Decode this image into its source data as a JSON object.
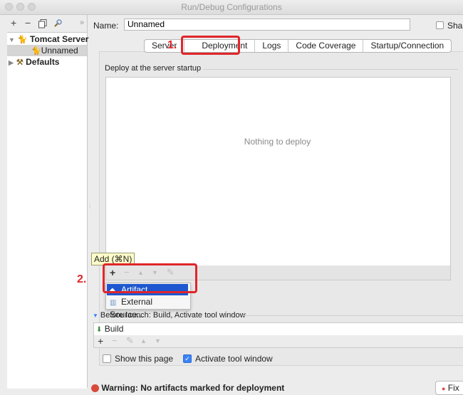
{
  "window": {
    "title": "Run/Debug Configurations"
  },
  "toolbar": {
    "add_icon": "+",
    "remove_icon": "−",
    "copy_icon": "copy-icon",
    "edit_icon": "wrench-icon",
    "more_icon": "»"
  },
  "tree": {
    "items": [
      {
        "label": "Tomcat Server",
        "level": 0,
        "expanded": true,
        "icon": "tomcat-icon"
      },
      {
        "label": "Unnamed",
        "level": 1,
        "selected": true,
        "icon": "tomcat-icon"
      },
      {
        "label": "Defaults",
        "level": 0,
        "expanded": false,
        "icon": "wrench-icon"
      }
    ]
  },
  "config": {
    "name_label": "Name:",
    "name_value": "Unnamed",
    "share_label": "Share"
  },
  "tabs": [
    {
      "label": "Server"
    },
    {
      "label": "Deployment",
      "selected": true
    },
    {
      "label": "Logs"
    },
    {
      "label": "Code Coverage"
    },
    {
      "label": "Startup/Connection"
    }
  ],
  "deployment": {
    "section_title": "Deploy at the server startup",
    "empty_text": "Nothing to deploy",
    "tooltip": "Add (⌘N)",
    "menu": [
      {
        "label": "Artifact...",
        "highlighted": true,
        "icon": "artifact-icon"
      },
      {
        "label": "External Source...",
        "icon": "external-source-icon"
      }
    ]
  },
  "annotations": {
    "step1": "1.",
    "step2": "2."
  },
  "before_launch": {
    "header": "Before launch: Build, Activate tool window",
    "items": [
      {
        "label": "Build",
        "icon": "build-icon"
      }
    ],
    "show_page_label": "Show this page",
    "show_page_checked": false,
    "activate_label": "Activate tool window",
    "activate_checked": true
  },
  "warning": {
    "text": "Warning: No artifacts marked for deployment",
    "fix_label": "Fix"
  },
  "colors": {
    "annotation_red": "#e0262a",
    "selection_blue": "#1e57cf",
    "tooltip_bg": "#fffdc9"
  }
}
